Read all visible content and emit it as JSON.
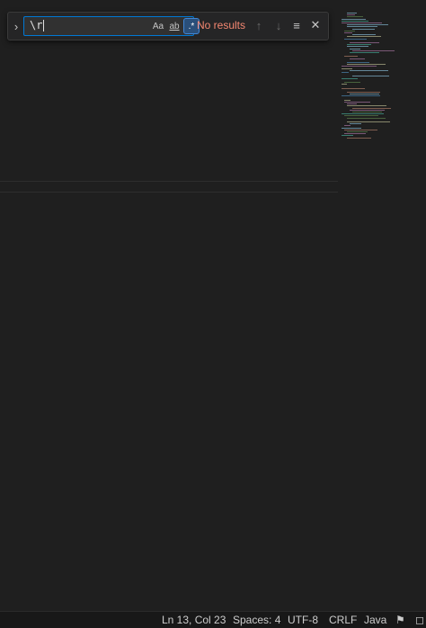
{
  "find": {
    "toggle_icon": "chevron-right-icon",
    "query": "\\r",
    "match_case_label": "Aa",
    "whole_word_label": "ab",
    "regex_label": ".*",
    "regex_active": true,
    "result_text": "No results",
    "colors": {
      "error": "#f48771",
      "accent": "#0078d4"
    }
  },
  "statusbar": {
    "position": "Ln 13, Col 23",
    "indent": "Spaces: 4",
    "encoding": "UTF-8",
    "eol": "CRLF",
    "language": "Java"
  }
}
